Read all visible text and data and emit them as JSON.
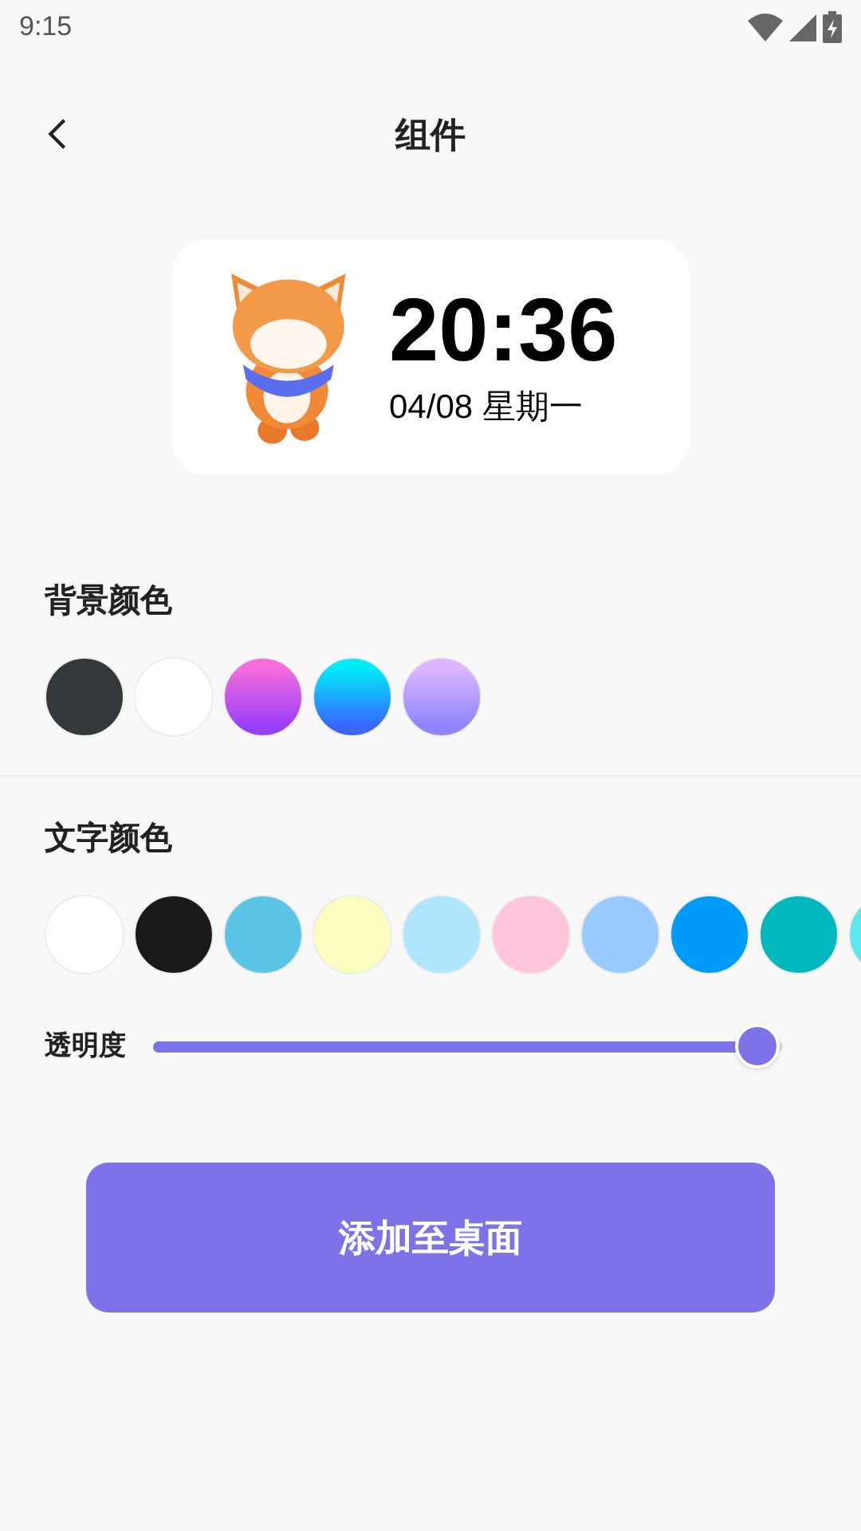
{
  "status_bar": {
    "time": "9:15"
  },
  "header": {
    "title": "组件"
  },
  "widget": {
    "time": "20:36",
    "date": "04/08 星期一"
  },
  "background_color": {
    "label": "背景颜色",
    "swatches": [
      {
        "color": "#33383b"
      },
      {
        "color": "#ffffff"
      },
      {
        "color": "#f56cdc",
        "gradient_end": {
          "color": "#9a3ff8"
        }
      },
      {
        "color": "#00ecf8",
        "gradient_end": {
          "color": "#3866ff"
        }
      },
      {
        "color": "#dcb6ff",
        "gradient_end": {
          "color": "#8e85fa"
        }
      }
    ]
  },
  "text_color": {
    "label": "文字颜色",
    "swatches": [
      {
        "color": "#ffffff"
      },
      {
        "color": "#1a1a1a"
      },
      {
        "color": "#5bc5e8"
      },
      {
        "color": "#fcfcbe"
      },
      {
        "color": "#ade6fd"
      },
      {
        "color": "#ffc5dc"
      },
      {
        "color": "#99caff"
      },
      {
        "color": "#009bf8"
      },
      {
        "color": "#00b8be"
      },
      {
        "color": "#5ce8ef"
      }
    ]
  },
  "opacity": {
    "label": "透明度",
    "level": 0.96
  },
  "add_button": {
    "label": "添加至桌面"
  }
}
